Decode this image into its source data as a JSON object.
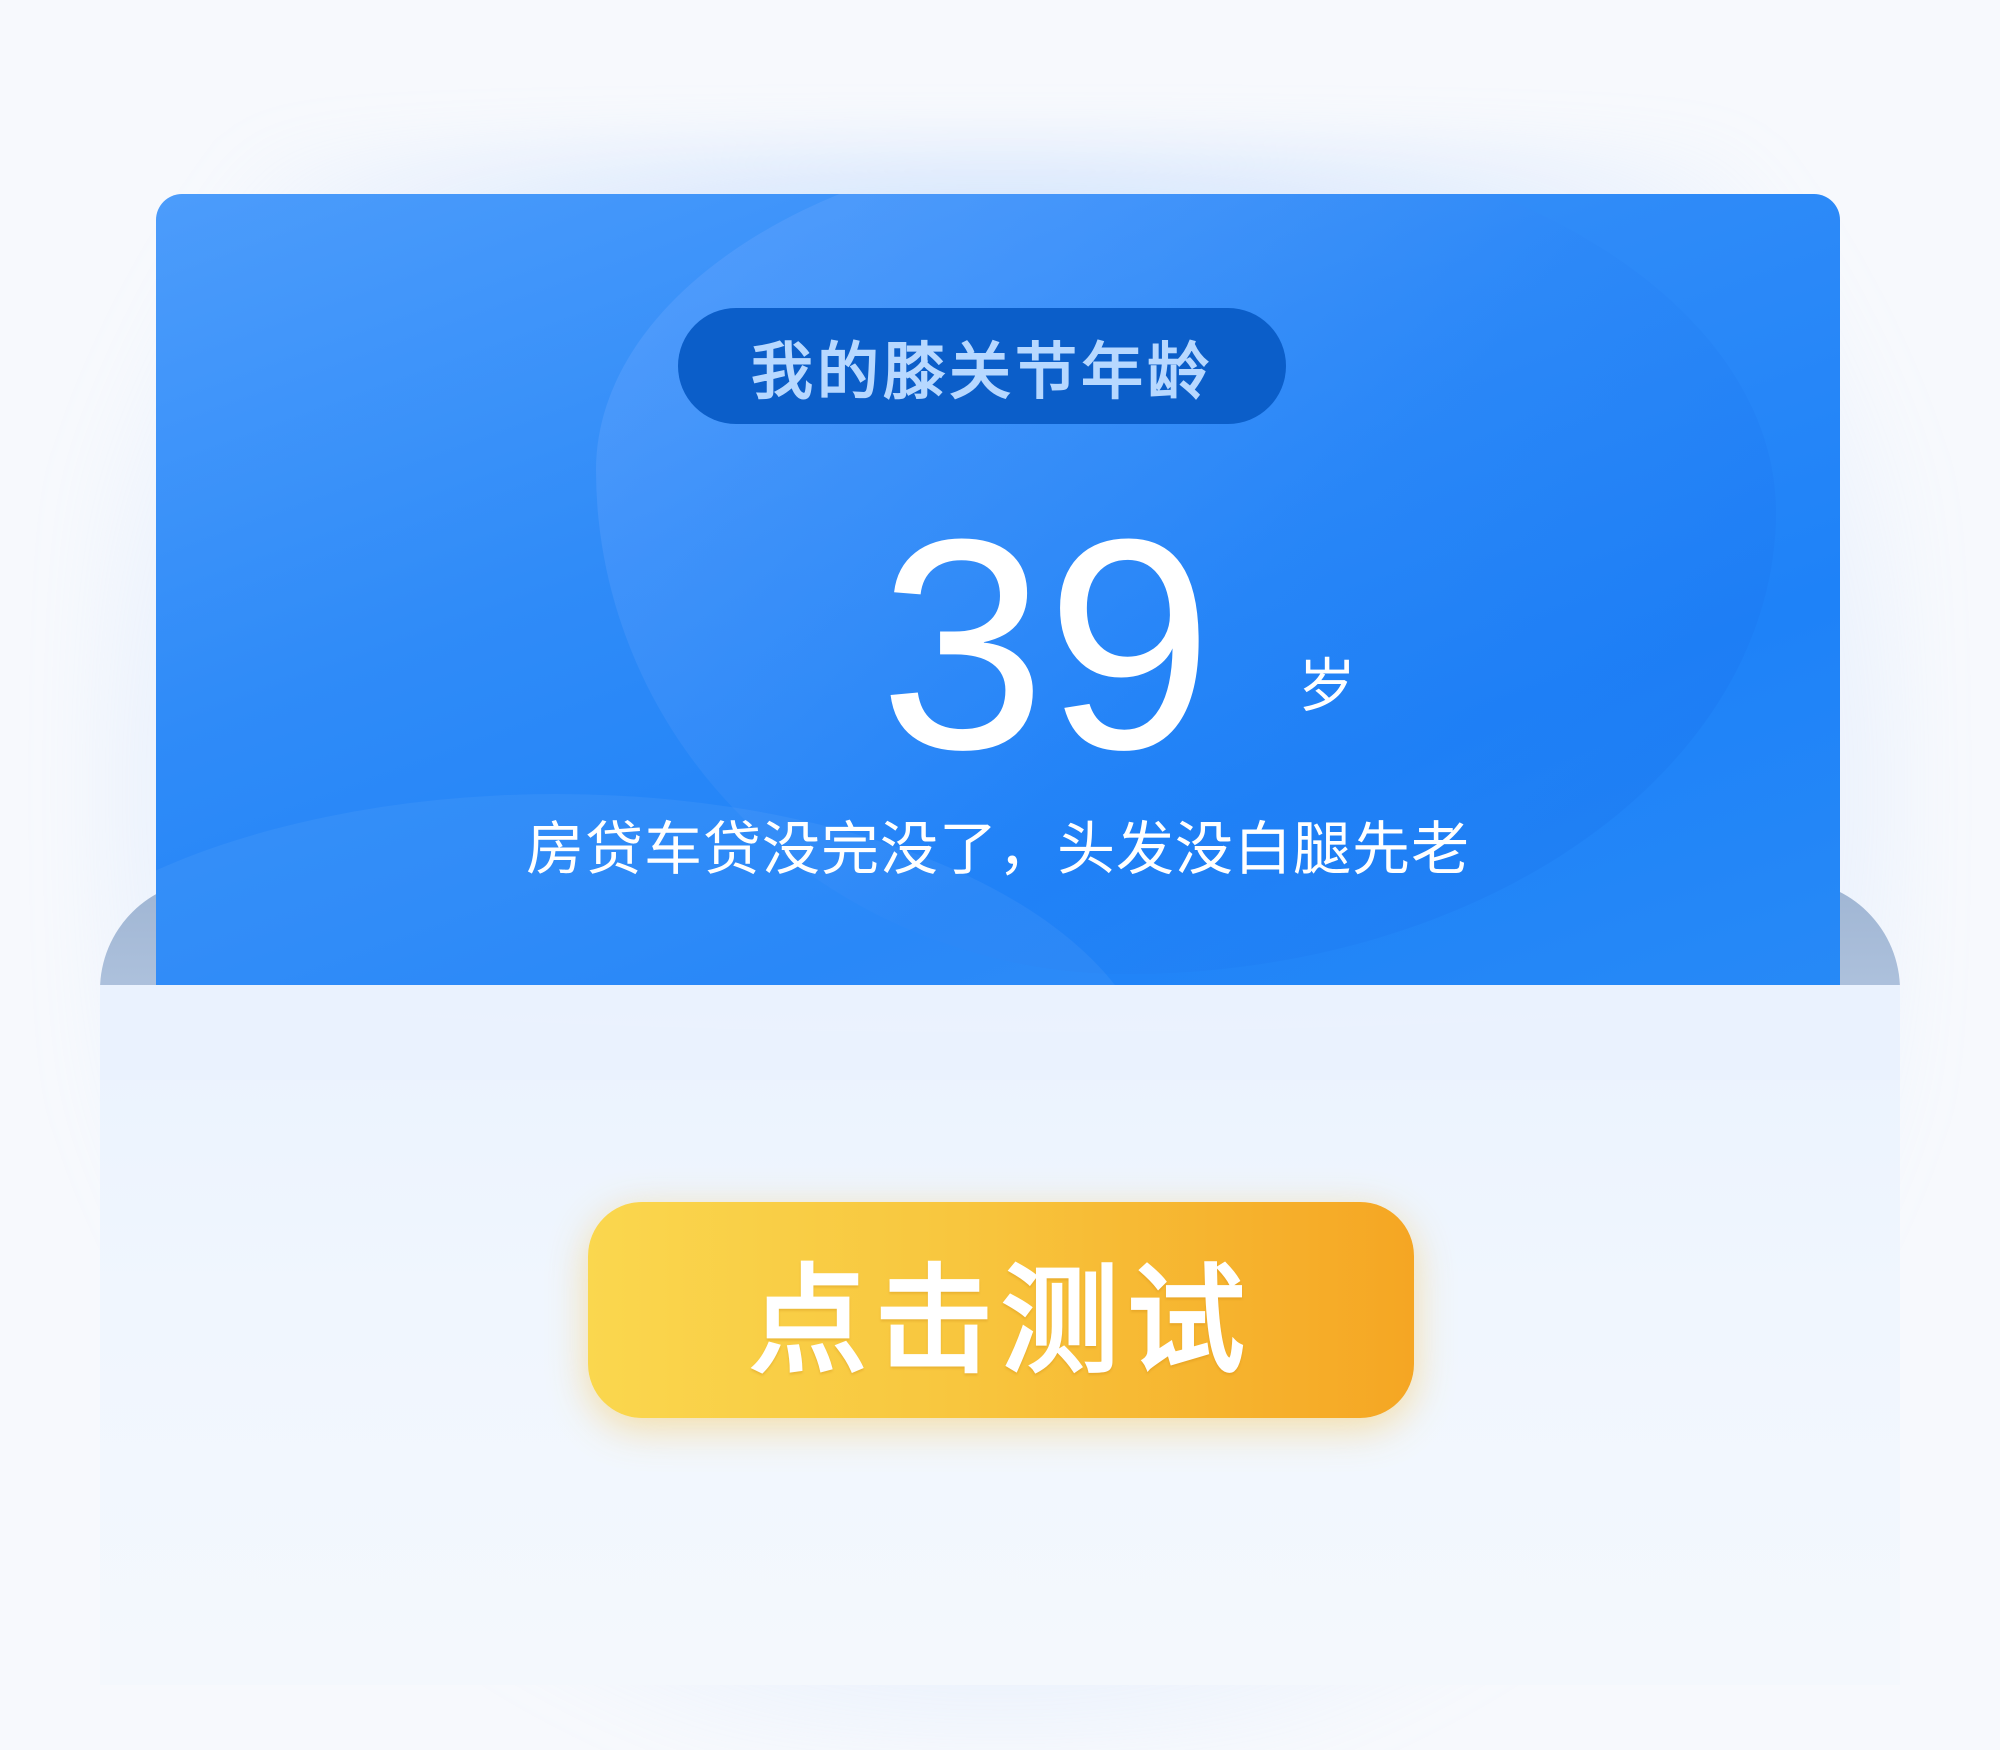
{
  "result_card": {
    "title": "我的膝关节年龄",
    "age": "39",
    "age_unit": "岁",
    "description": "房贷车贷没完没了，头发没白腿先老"
  },
  "cta": {
    "label": "点击测试"
  },
  "colors": {
    "card_blue": "#2f8bf8",
    "title_pill": "#0b5ec9",
    "button_start": "#fad74e",
    "button_end": "#f5a623",
    "background": "#f7f9fd"
  }
}
